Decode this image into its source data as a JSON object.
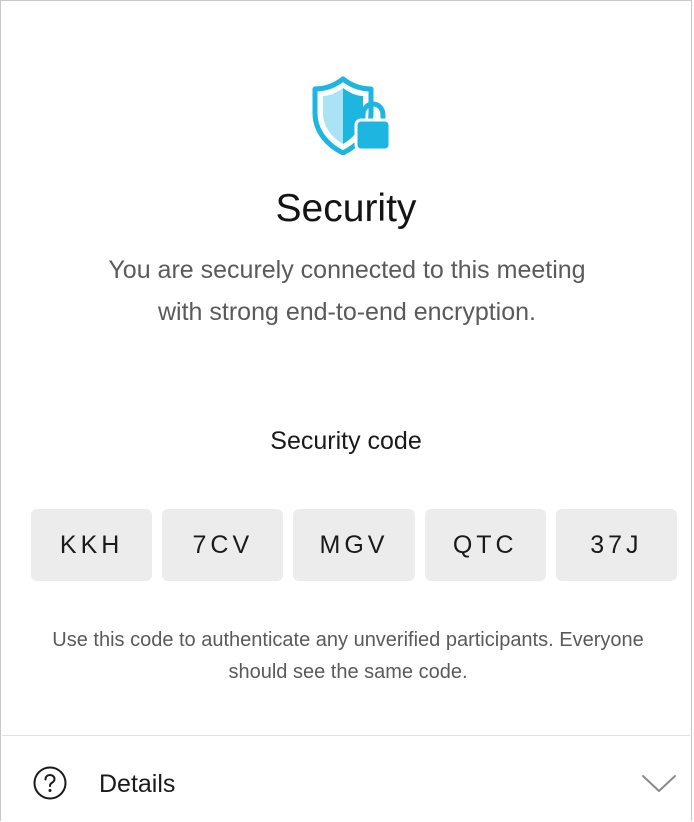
{
  "header": {
    "icon": "shield-lock-icon",
    "title": "Security",
    "description": "You are securely connected to this meeting with strong end-to-end encryption."
  },
  "security_code": {
    "label": "Security code",
    "segments": [
      "KKH",
      "7CV",
      "MGV",
      "QTC",
      "37J"
    ],
    "help_text": "Use this code to authenticate any unverified participants. Everyone should see the same code."
  },
  "details": {
    "icon": "question-circle-icon",
    "label": "Details",
    "chevron": "chevron-down-icon"
  },
  "colors": {
    "shield_accent": "#1cb6e0",
    "shield_light": "#a9e3f4",
    "code_box_bg": "#ececec",
    "secondary_text": "#5a5a5a"
  }
}
